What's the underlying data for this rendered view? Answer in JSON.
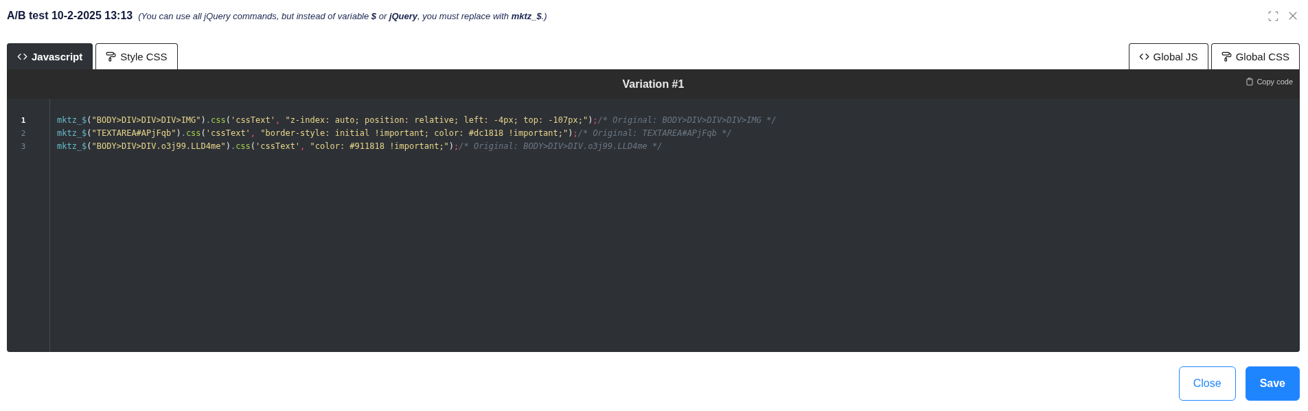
{
  "header": {
    "title": "A/B test 10-2-2025 13:13",
    "note": "(You can use all jQuery commands, but instead of variable **$** or **jQuery**, you must replace with **mktz_$**.)"
  },
  "tabs_left": [
    {
      "label": "Javascript",
      "kind": "code",
      "selected": true
    },
    {
      "label": "Style CSS",
      "kind": "style",
      "selected": false
    }
  ],
  "tabs_right": [
    {
      "label": "Global JS",
      "kind": "code",
      "selected": false
    },
    {
      "label": "Global CSS",
      "kind": "style",
      "selected": false
    }
  ],
  "editor": {
    "title": "Variation #1",
    "copy_label": "Copy code",
    "lines": [
      {
        "number": "1",
        "active": true,
        "tokens": [
          {
            "kind": "fn",
            "text": "mktz_$"
          },
          {
            "kind": "punct",
            "text": "("
          },
          {
            "kind": "string",
            "text": "\"BODY>DIV>DIV>DIV>IMG\""
          },
          {
            "kind": "punct",
            "text": ")"
          },
          {
            "kind": "dot",
            "text": "."
          },
          {
            "kind": "method",
            "text": "css"
          },
          {
            "kind": "punct",
            "text": "("
          },
          {
            "kind": "string",
            "text": "'cssText'"
          },
          {
            "kind": "sep",
            "text": ", "
          },
          {
            "kind": "string",
            "text": "\"z-index: auto; position: relative; left: -4px; top: -107px;\""
          },
          {
            "kind": "punct",
            "text": ")"
          },
          {
            "kind": "sep",
            "text": ";"
          },
          {
            "kind": "comment",
            "text": "/* Original: BODY>DIV>DIV>DIV>IMG */"
          }
        ]
      },
      {
        "number": "2",
        "active": false,
        "tokens": [
          {
            "kind": "fn",
            "text": "mktz_$"
          },
          {
            "kind": "punct",
            "text": "("
          },
          {
            "kind": "string",
            "text": "\"TEXTAREA#APjFqb\""
          },
          {
            "kind": "punct",
            "text": ")"
          },
          {
            "kind": "dot",
            "text": "."
          },
          {
            "kind": "method",
            "text": "css"
          },
          {
            "kind": "punct",
            "text": "("
          },
          {
            "kind": "string",
            "text": "'cssText'"
          },
          {
            "kind": "sep",
            "text": ", "
          },
          {
            "kind": "string",
            "text": "\"border-style: initial !important; color: #dc1818 !important;\""
          },
          {
            "kind": "punct",
            "text": ")"
          },
          {
            "kind": "sep",
            "text": ";"
          },
          {
            "kind": "comment",
            "text": "/* Original: TEXTAREA#APjFqb */"
          }
        ]
      },
      {
        "number": "3",
        "active": false,
        "tokens": [
          {
            "kind": "fn",
            "text": "mktz_$"
          },
          {
            "kind": "punct",
            "text": "("
          },
          {
            "kind": "string",
            "text": "\"BODY>DIV>DIV.o3j99.LLD4me\""
          },
          {
            "kind": "punct",
            "text": ")"
          },
          {
            "kind": "dot",
            "text": "."
          },
          {
            "kind": "method",
            "text": "css"
          },
          {
            "kind": "punct",
            "text": "("
          },
          {
            "kind": "string",
            "text": "'cssText'"
          },
          {
            "kind": "sep",
            "text": ", "
          },
          {
            "kind": "string",
            "text": "\"color: #911818 !important;\""
          },
          {
            "kind": "punct",
            "text": ")"
          },
          {
            "kind": "sep",
            "text": ";"
          },
          {
            "kind": "comment",
            "text": "/* Original: BODY>DIV>DIV.o3j99.LLD4me */"
          }
        ]
      }
    ]
  },
  "buttons": [
    {
      "label": "Close",
      "kind": "secondary"
    },
    {
      "label": "Save",
      "kind": "primary"
    }
  ]
}
